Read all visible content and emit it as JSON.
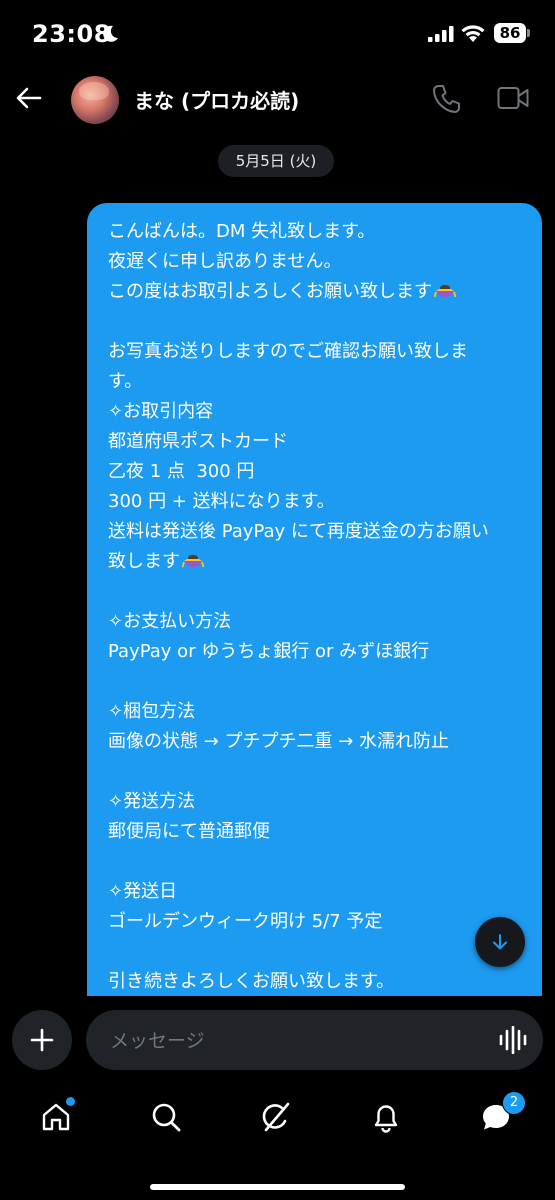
{
  "status_bar": {
    "time": "23:08",
    "battery": "86"
  },
  "header": {
    "contact_name": "まな (プロカ必読)"
  },
  "date_chip": "5月5日 (火)",
  "message": {
    "lines": [
      "こんばんは。DM 失礼致します。",
      "夜遅くに申し訳ありません。",
      "この度はお取引よろしくお願い致します",
      "",
      "お写真お送りしますのでご確認お願い致しま",
      "す。",
      "✧お取引内容",
      "都道府県ポストカード",
      "乙夜 1 点  300 円",
      "300 円 + 送料になります。",
      "送料は発送後 PayPay にて再度送金の方お願い",
      "致します",
      "",
      "✧お支払い方法",
      "PayPay or ゆうちょ銀行 or みずほ銀行",
      "",
      "✧梱包方法",
      "画像の状態 → プチプチ二重 → 水濡れ防止",
      "",
      "✧発送方法",
      "郵便局にて普通郵便",
      "",
      "✧発送日",
      "ゴールデンウィーク明け 5/7 予定",
      "",
      "引き続きよろしくお願い致します。"
    ],
    "bubble_color": "#1d9bf0"
  },
  "composer": {
    "placeholder": "メッセージ"
  },
  "bottom_nav": {
    "messages_badge": "2"
  },
  "icons": {
    "back": "back-arrow-icon",
    "phone": "phone-icon",
    "video": "video-camera-icon",
    "add": "plus-icon",
    "mic": "voice-wave-icon",
    "scroll": "arrow-down-icon",
    "home": "home-icon",
    "search": "search-icon",
    "grok": "grok-icon",
    "notifications": "bell-icon",
    "messages": "messages-icon"
  }
}
